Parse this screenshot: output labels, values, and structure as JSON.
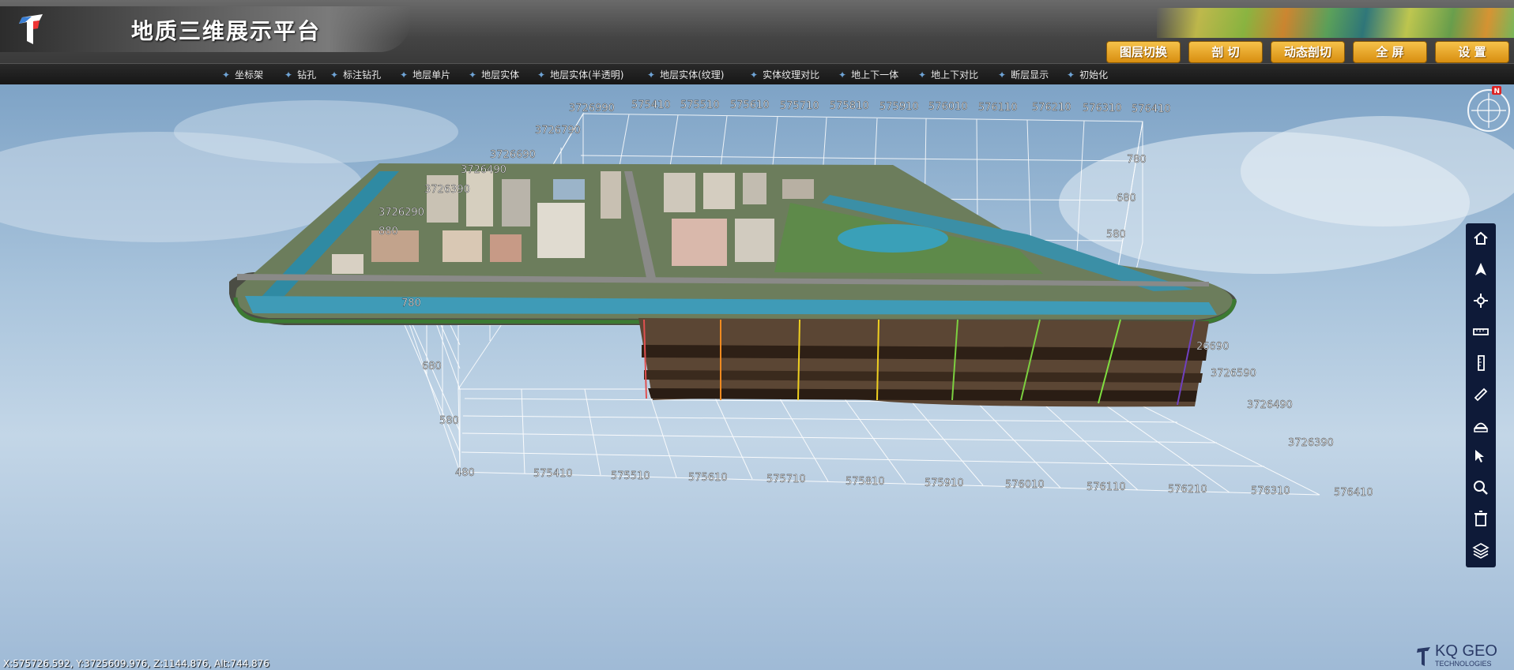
{
  "header": {
    "title": "地质三维展示平台",
    "buttons": [
      "图层切换",
      "剖 切",
      "动态剖切",
      "全 屏",
      "设 置"
    ]
  },
  "toolbar": {
    "items": [
      "坐标架",
      "钻孔",
      "标注钻孔",
      "地层单片",
      "地层实体",
      "地层实体(半透明)",
      "地层实体(纹理)",
      "实体纹理对比",
      "地上下一体",
      "地上下对比",
      "断层显示",
      "初始化"
    ]
  },
  "axes": {
    "x_top": [
      "3726990",
      "575410",
      "575510",
      "575610",
      "575710",
      "575810",
      "575910",
      "576010",
      "576110",
      "576210",
      "576310",
      "576410"
    ],
    "y_left": [
      "3726790",
      "3726690",
      "3726490",
      "3726390",
      "3726290"
    ],
    "z_left_top": [
      "880",
      "780"
    ],
    "z_right": [
      "780",
      "680",
      "580"
    ],
    "z_front": [
      "680",
      "580",
      "480"
    ],
    "x_bottom": [
      "575410",
      "575510",
      "575610",
      "575710",
      "575810",
      "575910",
      "576010",
      "576110",
      "576210",
      "576310",
      "576410"
    ],
    "y_right": [
      "26690",
      "3726590",
      "3726490",
      "3726390"
    ]
  },
  "compass": {
    "north_label": "N"
  },
  "side_tools": [
    "home-icon",
    "north-arrow-icon",
    "locate-icon",
    "ruler-icon",
    "vertical-measure-icon",
    "measure-icon",
    "area-measure-icon",
    "pointer-select-icon",
    "search-icon",
    "trash-icon",
    "layers-icon"
  ],
  "status": {
    "coordinates": "X:575726.592, Y:3725609.976, Z:1144.876, Alt:744.876"
  },
  "brand": {
    "name": "KQ GEO",
    "sub": "TECHNOLOGIES"
  },
  "colors": {
    "accent_button": "#e8a62a",
    "toolbar_bg": "#1b1b1b",
    "side_tools_bg": "#0e1a38"
  }
}
